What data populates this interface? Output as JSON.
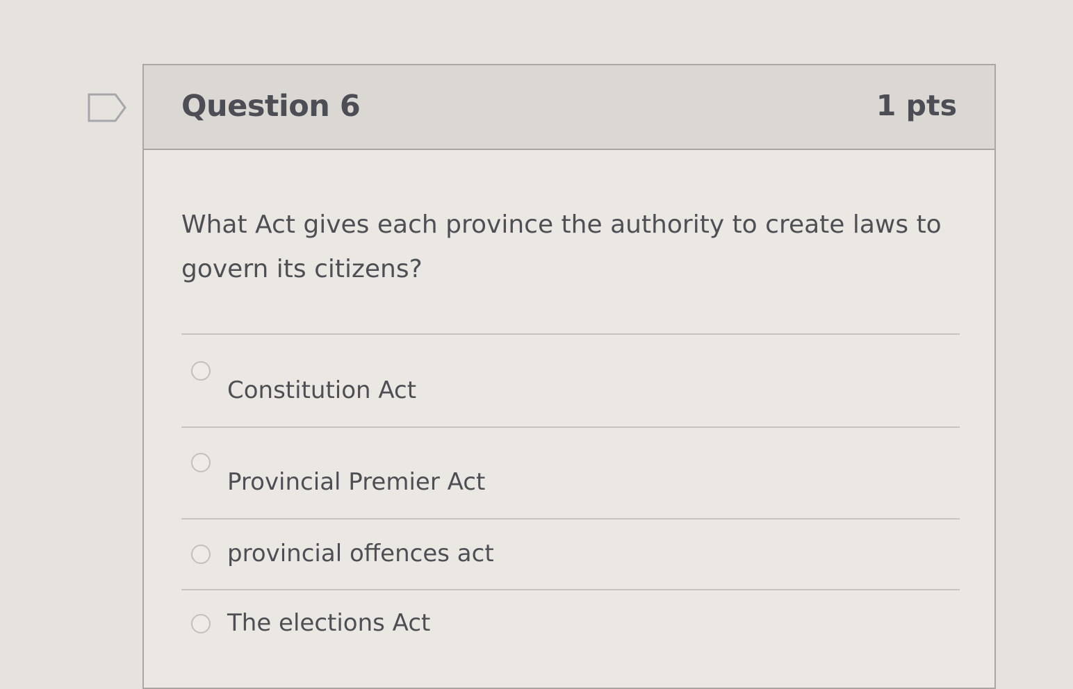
{
  "question": {
    "title": "Question 6",
    "points": "1 pts",
    "text": "What Act gives each province the authority to create laws to govern its citizens?",
    "flag_icon": "flag-icon"
  },
  "answers": [
    {
      "label": "Constitution Act",
      "selected": false
    },
    {
      "label": "Provincial Premier Act",
      "selected": false
    },
    {
      "label": "provincial offences act",
      "selected": false
    },
    {
      "label": "The elections Act",
      "selected": false
    }
  ],
  "colors": {
    "page_background": "#e6e3df",
    "header_background": "#dbd8d4",
    "text": "#4e4f55",
    "border": "#a9a6a2"
  }
}
